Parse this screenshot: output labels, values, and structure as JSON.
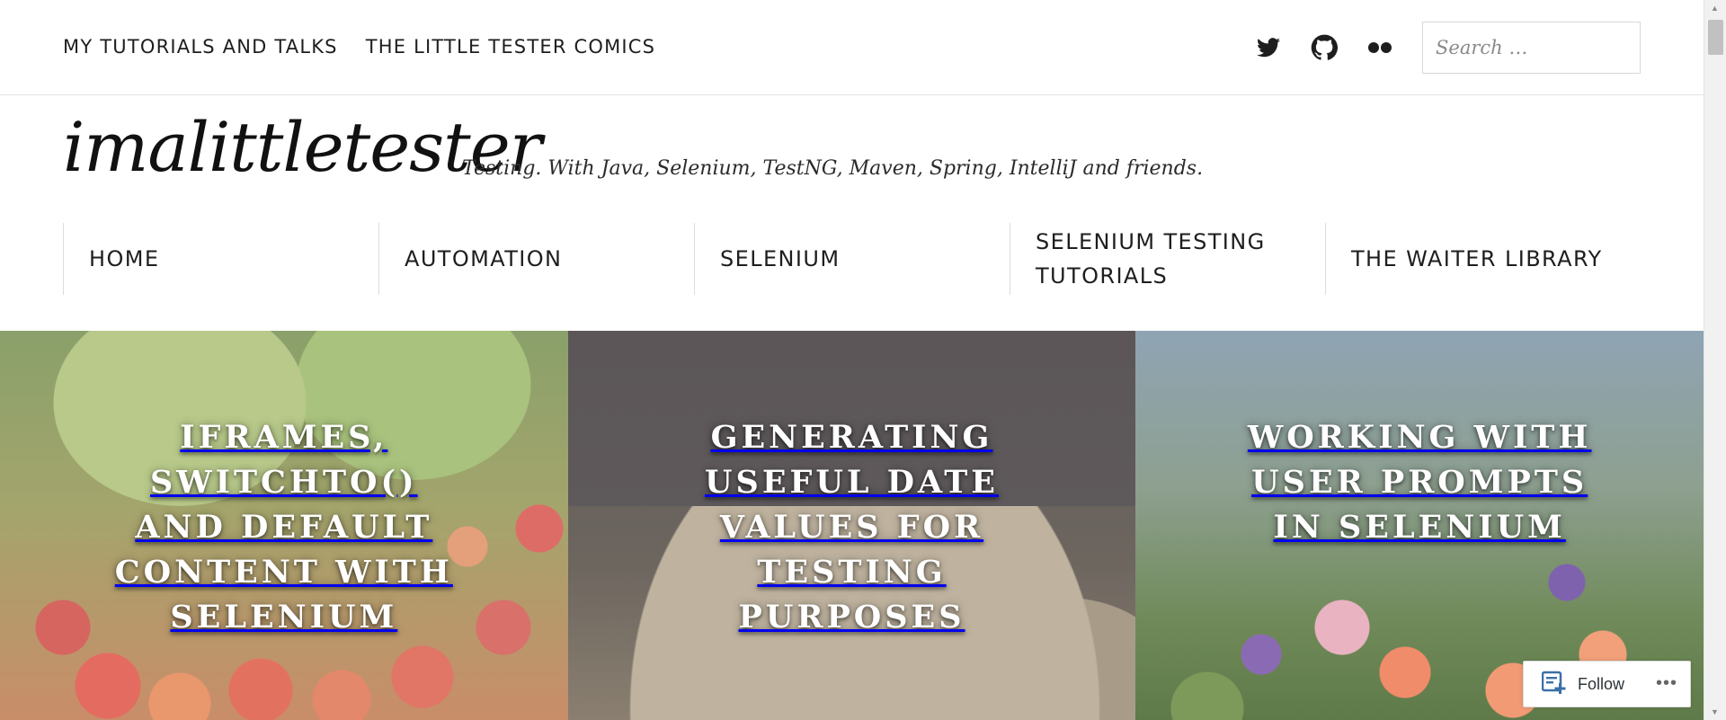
{
  "top_menu": {
    "items": [
      "MY TUTORIALS AND TALKS",
      "THE LITTLE TESTER COMICS"
    ]
  },
  "social": {
    "icons": [
      "twitter-icon",
      "github-icon",
      "flickr-icon"
    ]
  },
  "search": {
    "placeholder": "Search …"
  },
  "site": {
    "title": "imalittletester",
    "description": "Testing. With Java, Selenium, TestNG, Maven, Spring, IntelliJ and friends."
  },
  "nav": {
    "items": [
      "HOME",
      "AUTOMATION",
      "SELENIUM",
      "SELENIUM TESTING TUTORIALS",
      "THE WAITER LIBRARY"
    ]
  },
  "featured": [
    {
      "title": "IFRAMES, SWITCHTO() AND DEFAULT CONTENT WITH SELENIUM"
    },
    {
      "title": "GENERATING USEFUL DATE VALUES FOR TESTING PURPOSES"
    },
    {
      "title": "WORKING WITH USER PROMPTS IN SELENIUM"
    }
  ],
  "follow": {
    "label": "Follow",
    "more": "•••"
  },
  "colors": {
    "text": "#1e1e1e",
    "border": "#dcdcdc",
    "title_text": "#ffffff"
  }
}
